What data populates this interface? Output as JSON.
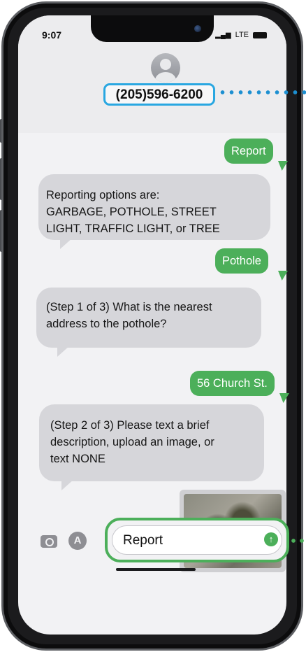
{
  "status_bar": {
    "time": "9:07",
    "network": "LTE"
  },
  "contact": {
    "phone_number": "(205)596-6200"
  },
  "messages": [
    {
      "direction": "outgoing",
      "text": "Report"
    },
    {
      "direction": "incoming",
      "lines": [
        "Reporting options are:",
        "GARBAGE, POTHOLE, STREET",
        "LIGHT, TRAFFIC LIGHT, or TREE"
      ]
    },
    {
      "direction": "outgoing",
      "text": "Pothole"
    },
    {
      "direction": "incoming",
      "lines": [
        "(Step 1 of 3) What is the nearest",
        "address to the pothole?"
      ]
    },
    {
      "direction": "outgoing",
      "text": "56 Church St."
    },
    {
      "direction": "incoming",
      "lines": [
        "(Step 2 of 3) Please text a brief",
        "description, upload an image, or",
        "text NONE"
      ]
    }
  ],
  "composer": {
    "value": "Report"
  },
  "colors": {
    "outgoing_bubble": "#4caf5a",
    "incoming_bubble": "#d6d6da",
    "highlight_blue": "#29a7e1",
    "highlight_green": "#4caf5a"
  }
}
